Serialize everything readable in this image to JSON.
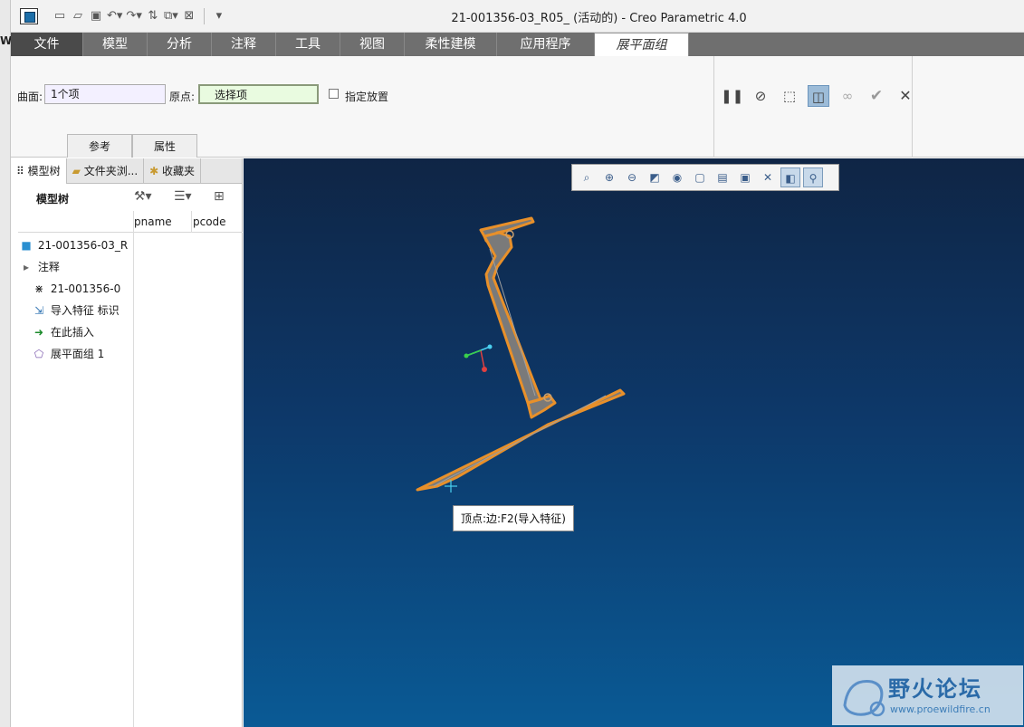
{
  "window": {
    "title": "21-001356-03_R05_ (活动的) - Creo Parametric 4.0"
  },
  "left_strip_char": "W",
  "quick_access": [
    "new-file-icon",
    "open-folder-icon",
    "save-icon",
    "undo-icon",
    "redo-icon",
    "regenerate-icon",
    "windows-icon",
    "close-window-icon",
    "customize-dropdown-icon"
  ],
  "tabs": [
    {
      "label": "文件"
    },
    {
      "label": "模型"
    },
    {
      "label": "分析"
    },
    {
      "label": "注释"
    },
    {
      "label": "工具"
    },
    {
      "label": "视图"
    },
    {
      "label": "柔性建模"
    },
    {
      "label": "应用程序"
    },
    {
      "label": "展平面组"
    }
  ],
  "ribbon": {
    "surface_label": "曲面:",
    "surface_value": "1个项",
    "origin_label": "原点:",
    "origin_value": "选择项",
    "placement_label": "指定放置",
    "subtabs": [
      "参考",
      "属性"
    ]
  },
  "navigator": {
    "tabs": [
      "模型树",
      "文件夹浏...",
      "收藏夹"
    ],
    "model_tree_title": "模型树",
    "columns": [
      "pname",
      "pcode"
    ],
    "tree": [
      {
        "label": "21-001356-03_R",
        "icon": "part-icon"
      },
      {
        "label": "注释",
        "icon": "expand-arrow-icon"
      },
      {
        "label": "21-001356-0",
        "icon": "csys-icon"
      },
      {
        "label": "导入特征 标识",
        "icon": "import-feature-icon"
      },
      {
        "label": "在此插入",
        "icon": "insert-here-arrow-icon"
      },
      {
        "label": "展平面组 1",
        "icon": "flatten-quilt-icon"
      }
    ]
  },
  "viewport": {
    "tooltip": "顶点:边:F2(导入特征)"
  },
  "watermark": {
    "title": "野火论坛",
    "url": "www.proewildfire.cn"
  },
  "colors": {
    "accent_orange": "#e8902a",
    "viewport_top": "#0f2545",
    "viewport_bottom": "#0a5a95"
  }
}
